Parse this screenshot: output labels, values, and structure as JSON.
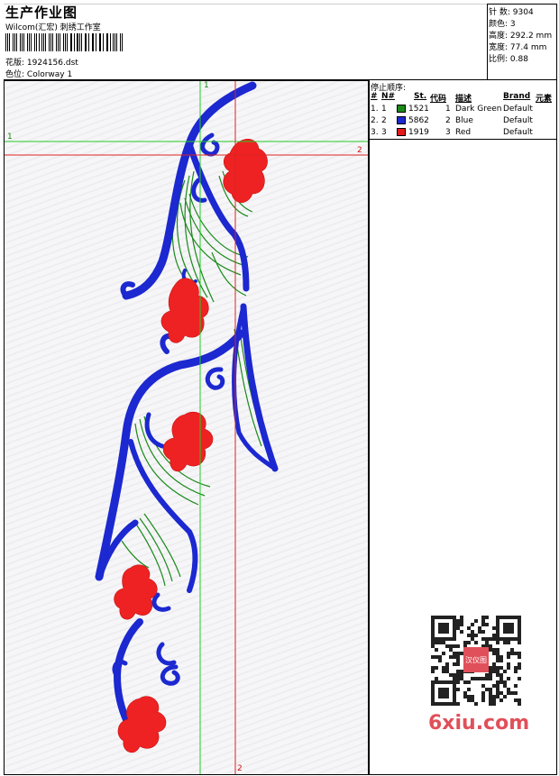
{
  "header": {
    "title": "生产作业图",
    "company": "Wilcom(汇宏) 刺绣工作室",
    "design_label": "花版:",
    "design_value": "1924156.dst",
    "color_label": "色位:",
    "color_value": "Colorway 1"
  },
  "stats": {
    "stitches_label": "针 数:",
    "stitches_value": "9304",
    "colors_label": "颜色:",
    "colors_value": "3",
    "height_label": "高度:",
    "height_value": "292.2 mm",
    "width_label": "宽度:",
    "width_value": "77.4 mm",
    "scale_label": "比例:",
    "scale_value": "0.88"
  },
  "stop_sequence": {
    "label": "停止顺序:",
    "headers": [
      "#",
      "N#",
      "St.",
      "代码",
      "描述",
      "Brand",
      "元素"
    ],
    "rows": [
      {
        "idx": "1.",
        "n": "1",
        "color": "#1a8a1a",
        "stitches": "1521",
        "code": "1",
        "desc": "Dark Green",
        "brand": "Default"
      },
      {
        "idx": "2.",
        "n": "2",
        "color": "#1c28d0",
        "stitches": "5862",
        "code": "2",
        "desc": "Blue",
        "brand": "Default"
      },
      {
        "idx": "3.",
        "n": "3",
        "color": "#e41a1a",
        "stitches": "1919",
        "code": "3",
        "desc": "Red",
        "brand": "Default"
      }
    ]
  },
  "guides": {
    "green_v": "1",
    "green_h": "1",
    "red_h": "2",
    "red_v": "2"
  },
  "watermark": {
    "text": "6xiu.com",
    "stamp": "汉仪图"
  },
  "colors": {
    "green": "#1a8a1a",
    "blue": "#1c28d0",
    "red": "#e41a1a",
    "guide_green": "#22cc22",
    "guide_red": "#dd2222"
  }
}
